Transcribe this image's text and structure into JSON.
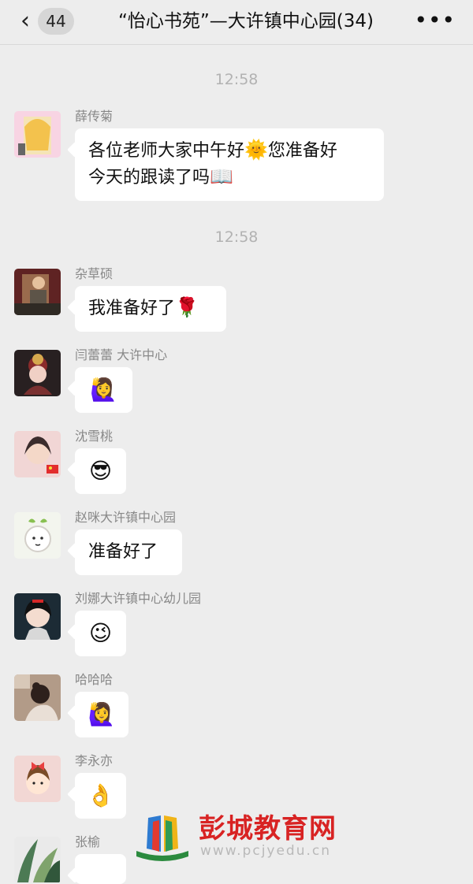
{
  "header": {
    "back_icon": "chevron-left-icon",
    "unread_count": "44",
    "title": "“怡心书苑”—大许镇中心园(34)",
    "more_icon": "more-dots-icon"
  },
  "timestamps": [
    "12:58",
    "12:58"
  ],
  "messages": [
    {
      "sender": "薛传菊",
      "text_line1": "各位老师大家中午好",
      "text_line1_end": "您准备好",
      "text_line2": "今天的跟读了吗",
      "emoji_1": "🌞",
      "emoji_2": "📖"
    },
    {
      "sender": "杂草硕",
      "text": "我准备好了",
      "emoji": "🌹"
    },
    {
      "sender": "闫蕾蕾 大许中心",
      "emoji": "🙋‍♀️"
    },
    {
      "sender": "沈雪桃",
      "emoji": "😎"
    },
    {
      "sender": "赵咪大许镇中心园",
      "text": "准备好了"
    },
    {
      "sender": "刘娜大许镇中心幼儿园",
      "emoji": "😉"
    },
    {
      "sender": "哈哈哈",
      "emoji": "🙋‍♀️"
    },
    {
      "sender": "李永亦",
      "emoji": "👌"
    },
    {
      "sender": "张榆"
    }
  ],
  "watermark": {
    "title": "彭城教育网",
    "url": "www.pcjyedu.cn"
  },
  "colors": {
    "background": "#ededed",
    "bubble": "#ffffff",
    "sender_name": "#888888",
    "timestamp": "#b2b2b2",
    "watermark": "#d82323"
  }
}
